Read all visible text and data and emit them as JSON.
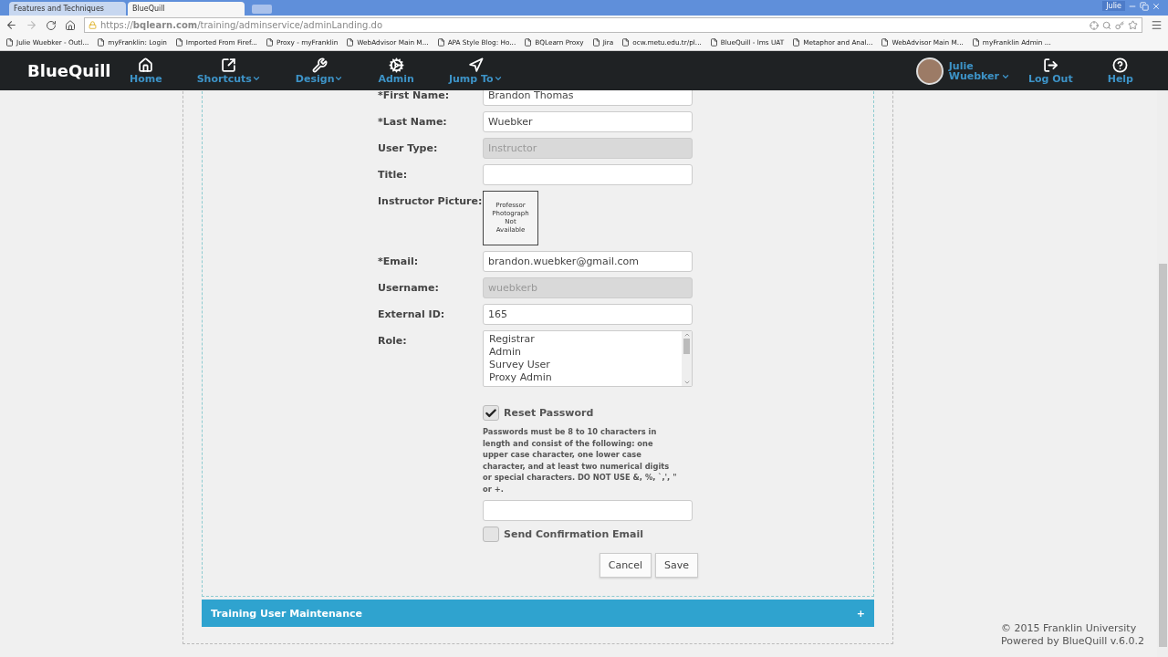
{
  "browser": {
    "tabs": [
      {
        "title": "Features and Techniques",
        "selected": false
      },
      {
        "title": "BlueQuill",
        "selected": true
      }
    ],
    "profile": "Julie",
    "url": "https://**bqlearn.com**/training/adminservice/adminLanding.do",
    "bookmarks": [
      "Julie Wuebker - Outl...",
      "myFranklin: Login",
      "Imported From Firef...",
      "Proxy - myFranklin",
      "WebAdvisor Main M...",
      "APA Style Blog: Ho...",
      "BQLearn Proxy",
      "Jira",
      "ocw.metu.edu.tr/pl...",
      "BlueQuill - lms UAT",
      "Metaphor and Anal...",
      "WebAdvisor Main M...",
      "myFranklin Admin ..."
    ]
  },
  "nav": {
    "logo": "BlueQuill",
    "items": [
      {
        "kind": "home",
        "label": "Home",
        "caret": false
      },
      {
        "kind": "shortcuts",
        "label": "Shortcuts",
        "caret": true
      },
      {
        "kind": "design",
        "label": "Design",
        "caret": true
      },
      {
        "kind": "admin",
        "label": "Admin",
        "caret": false
      },
      {
        "kind": "jump",
        "label": "Jump To",
        "caret": true
      }
    ],
    "user": {
      "first": "Julie",
      "last": "Wuebker"
    },
    "logout": "Log Out",
    "help": "Help"
  },
  "form": {
    "fields": [
      {
        "kind": "text",
        "label": "*First Name:",
        "value": "Brandon Thomas"
      },
      {
        "kind": "text",
        "label": "*Last Name:",
        "value": "Wuebker"
      },
      {
        "kind": "readonly",
        "label": "User Type:",
        "value": "Instructor"
      },
      {
        "kind": "text",
        "label": "Title:"
      },
      {
        "kind": "picture",
        "label": "Instructor Picture:",
        "lines": [
          "Professor",
          "Photograph",
          "Not",
          "Available"
        ]
      },
      {
        "kind": "text",
        "label": "*Email:",
        "value": "brandon.wuebker@gmail.com"
      },
      {
        "kind": "readonly",
        "label": "Username:",
        "value": "wuebkerb"
      },
      {
        "kind": "text",
        "label": "External ID:",
        "value": "165"
      },
      {
        "kind": "listbox",
        "label": "Role:",
        "options": [
          "Registrar",
          "Admin",
          "Survey User",
          "Proxy Admin"
        ]
      }
    ],
    "reset_password": {
      "label": "Reset Password",
      "checked": true
    },
    "password_rules": "Passwords must be 8 to 10 characters in length and consist of the following: one upper case character, one lower case character, and at least two numerical digits or special characters.   DO NOT USE &, %, `,', \" or +.",
    "send_confirmation": {
      "label": "Send Confirmation Email",
      "checked": false
    },
    "buttons": [
      "Cancel",
      "Save"
    ]
  },
  "section_bar": {
    "title": "Training User Maintenance",
    "toggle": "+"
  },
  "footer": [
    "© 2015 Franklin University",
    "Powered by BlueQuill v.6.0.2"
  ]
}
